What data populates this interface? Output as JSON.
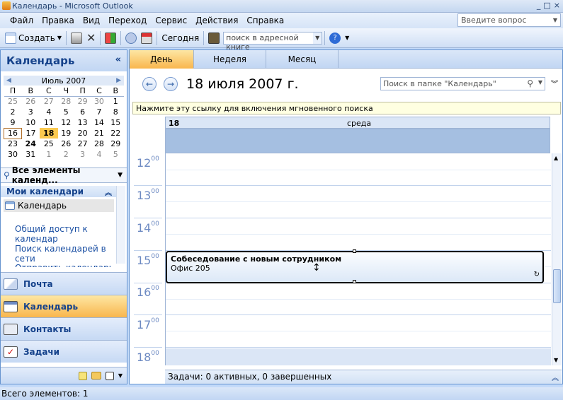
{
  "window": {
    "title": "Календарь - Microsoft Outlook",
    "controls": [
      "_",
      "□",
      "×"
    ]
  },
  "menu": [
    "Файл",
    "Правка",
    "Вид",
    "Переход",
    "Сервис",
    "Действия",
    "Справка"
  ],
  "ask_box": {
    "placeholder": "Введите вопрос"
  },
  "toolbar": {
    "create_label": "Создать",
    "today_label": "Сегодня",
    "address_search_placeholder": "поиск в адресной книге"
  },
  "nav": {
    "title": "Календарь",
    "collapse_glyph": "«",
    "mini_calendar": {
      "month_label": "Июль 2007",
      "weekdays": [
        "П",
        "В",
        "С",
        "Ч",
        "П",
        "С",
        "В"
      ],
      "weeks": [
        [
          "25",
          "26",
          "27",
          "28",
          "29",
          "30",
          "1"
        ],
        [
          "2",
          "3",
          "4",
          "5",
          "6",
          "7",
          "8"
        ],
        [
          "9",
          "10",
          "11",
          "12",
          "13",
          "14",
          "15"
        ],
        [
          "16",
          "17",
          "18",
          "19",
          "20",
          "21",
          "22"
        ],
        [
          "23",
          "24",
          "25",
          "26",
          "27",
          "28",
          "29"
        ],
        [
          "30",
          "31",
          "1",
          "2",
          "3",
          "4",
          "5"
        ]
      ]
    },
    "view_selector": "Все элементы календ...",
    "my_calendars_header": "Мои календари",
    "calendar_item": "Календарь",
    "links": [
      "Общий доступ к календар",
      "Поиск календарей в сети",
      "Отправить календарь по э"
    ],
    "buttons": [
      {
        "label": "Почта",
        "icon": "mail-icon"
      },
      {
        "label": "Календарь",
        "icon": "calendar-icon"
      },
      {
        "label": "Контакты",
        "icon": "contacts-icon"
      },
      {
        "label": "Задачи",
        "icon": "tasks-icon"
      }
    ]
  },
  "main": {
    "tabs": [
      "День",
      "Неделя",
      "Месяц"
    ],
    "active_tab": "День",
    "date_title": "18 июля 2007 г.",
    "folder_search_placeholder": "Поиск в папке \"Календарь\"",
    "info_bar": "Нажмите эту ссылку для включения мгновенного поиска",
    "day_header": {
      "num": "18",
      "weekday": "среда"
    },
    "hours": [
      "12",
      "13",
      "14",
      "15",
      "16",
      "17",
      "18"
    ],
    "hour_suffix": "00",
    "appointment": {
      "subject": "Собеседование с новым сотрудником",
      "location": "Офис 205"
    },
    "tasks_bar": "Задачи: 0 активных, 0 завершенных"
  },
  "status": {
    "text": "Всего элементов: 1"
  },
  "colors": {
    "accent": "#fbc94f",
    "frame": "#6593cf",
    "header_blue": "#15428b"
  }
}
